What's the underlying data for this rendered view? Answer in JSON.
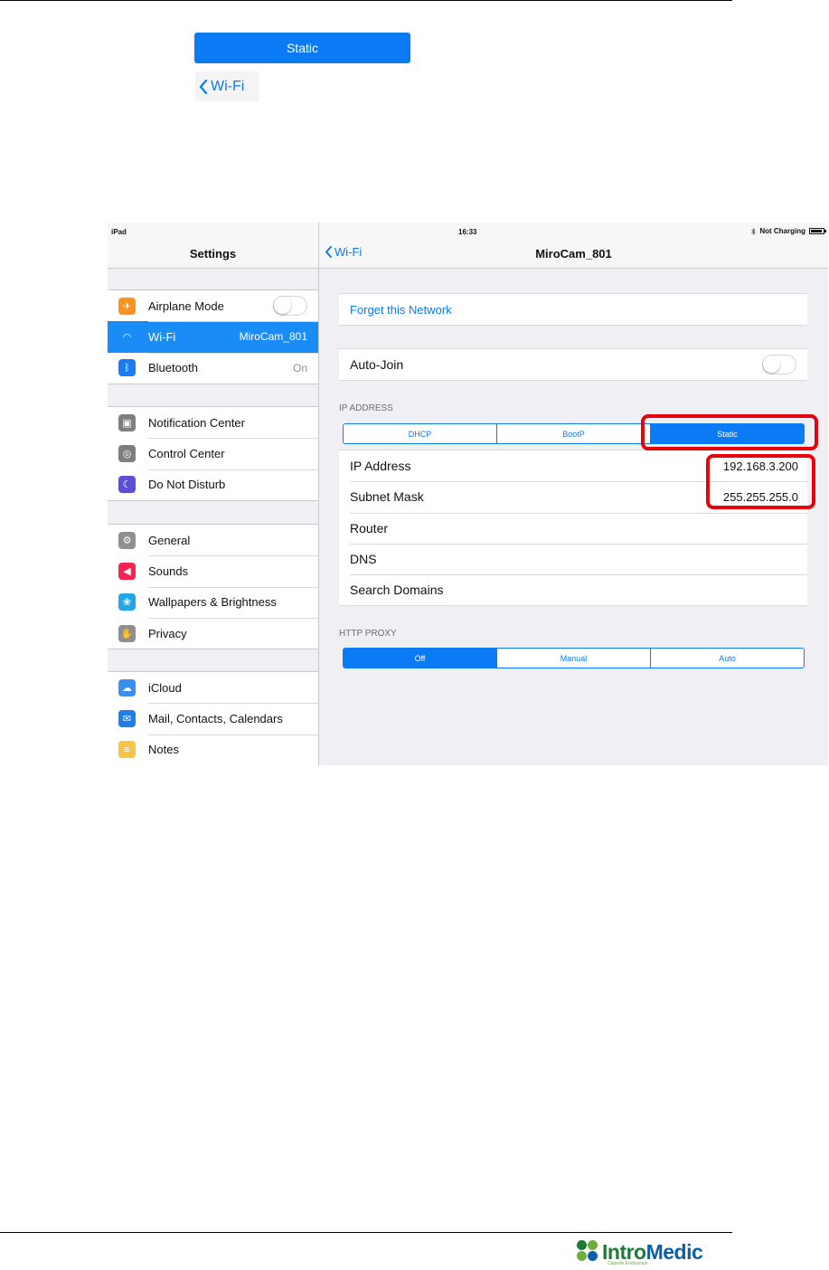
{
  "top_badges": {
    "static_label": "Static",
    "back_label": "Wi-Fi"
  },
  "statusbar": {
    "device": "iPad",
    "time": "16:33",
    "charging": "Not Charging"
  },
  "master": {
    "title": "Settings",
    "groups": [
      [
        {
          "label": "Airplane Mode",
          "value": "",
          "icon": "airplane-icon",
          "color": "#f7931e",
          "toggle": true,
          "selected": false
        },
        {
          "label": "Wi-Fi",
          "value": "MiroCam_801",
          "icon": "wifi-icon",
          "color": "#1a8cf5",
          "toggle": false,
          "selected": true
        },
        {
          "label": "Bluetooth",
          "value": "On",
          "icon": "bluetooth-icon",
          "color": "#1a7cf0",
          "toggle": false,
          "selected": false
        }
      ],
      [
        {
          "label": "Notification Center",
          "value": "",
          "icon": "notification-icon",
          "color": "#7d7d82",
          "selected": false
        },
        {
          "label": "Control Center",
          "value": "",
          "icon": "control-center-icon",
          "color": "#7d7d82",
          "selected": false
        },
        {
          "label": "Do Not Disturb",
          "value": "",
          "icon": "moon-icon",
          "color": "#5b4fd6",
          "selected": false
        }
      ],
      [
        {
          "label": "General",
          "value": "",
          "icon": "gear-icon",
          "color": "#8e8e93",
          "selected": false
        },
        {
          "label": "Sounds",
          "value": "",
          "icon": "speaker-icon",
          "color": "#f5234f",
          "selected": false
        },
        {
          "label": "Wallpapers & Brightness",
          "value": "",
          "icon": "flower-icon",
          "color": "#22a6e8",
          "selected": false
        },
        {
          "label": "Privacy",
          "value": "",
          "icon": "hand-icon",
          "color": "#8e8e93",
          "selected": false
        }
      ],
      [
        {
          "label": "iCloud",
          "value": "",
          "icon": "cloud-icon",
          "color": "#3a8ef0",
          "selected": false
        },
        {
          "label": "Mail, Contacts, Calendars",
          "value": "",
          "icon": "mail-icon",
          "color": "#1f7de8",
          "selected": false
        },
        {
          "label": "Notes",
          "value": "",
          "icon": "notes-icon",
          "color": "#f6c543",
          "selected": false
        }
      ]
    ]
  },
  "detail": {
    "back_label": "Wi-Fi",
    "title": "MiroCam_801",
    "forget_label": "Forget this Network",
    "auto_join_label": "Auto-Join",
    "ip_section": "IP ADDRESS",
    "ip_modes": [
      "DHCP",
      "BootP",
      "Static"
    ],
    "ip_mode_selected": "Static",
    "fields": [
      {
        "label": "IP Address",
        "value": "192.168.3.200"
      },
      {
        "label": "Subnet Mask",
        "value": "255.255.255.0"
      },
      {
        "label": "Router",
        "value": ""
      },
      {
        "label": "DNS",
        "value": ""
      },
      {
        "label": "Search Domains",
        "value": ""
      }
    ],
    "proxy_section": "HTTP PROXY",
    "proxy_modes": [
      "Off",
      "Manual",
      "Auto"
    ],
    "proxy_selected": "Off"
  },
  "highlight_color": "#e8000b",
  "accent_color": "#0a7bf5",
  "logo": {
    "text_a": "Intro",
    "text_b": "Medic",
    "tagline": "Capsule Endoscope"
  }
}
